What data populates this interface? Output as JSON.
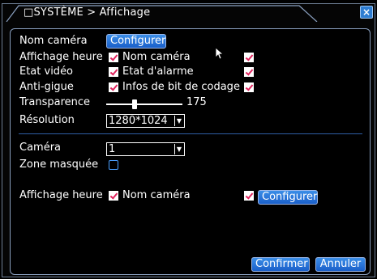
{
  "window": {
    "title": "□SYSTÈME > Affichage",
    "close_label": "×"
  },
  "form": {
    "camera_name_label": "Nom caméra",
    "configure_button": "Configurer",
    "show_time_label": "Affichage heure",
    "show_time_checked": true,
    "camera_name_check_label": "Nom caméra",
    "camera_name_checked": true,
    "video_state_label": "Etat vidéo",
    "video_state_checked": true,
    "alarm_state_label": "Etat d'alarme",
    "alarm_state_checked": true,
    "anti_flicker_label": "Anti-gigue",
    "anti_flicker_checked": true,
    "bitrate_info_label": "Infos de bit de codage",
    "bitrate_info_checked": true,
    "transparency_label": "Transparence",
    "transparency_value": "175",
    "transparency_fraction": 0.37,
    "resolution_label": "Résolution",
    "resolution_value": "1280*1024",
    "camera_label": "Caméra",
    "camera_value": "1",
    "mask_zone_label": "Zone masquée",
    "mask_zone_checked": false,
    "cam_show_time_label": "Affichage heure",
    "cam_show_time_checked": true,
    "cam_name_label": "Nom caméra",
    "cam_name_checked": true,
    "cam_configure_button": "Configurer"
  },
  "footer": {
    "confirm_button": "Confirmer",
    "cancel_button": "Annuler"
  }
}
